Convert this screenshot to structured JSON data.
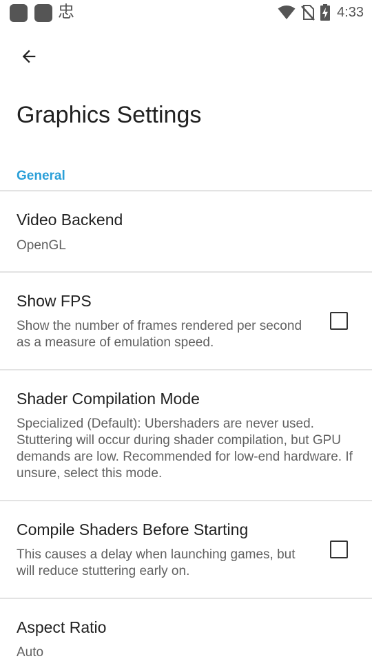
{
  "status_bar": {
    "glyph": "忠",
    "time": "4:33",
    "icons": [
      "app-icon",
      "app-icon",
      "wifi-icon",
      "no-sim-icon",
      "battery-charging-icon"
    ]
  },
  "toolbar": {
    "back_icon": "arrow-back-icon",
    "title": "Graphics Settings"
  },
  "category": "General",
  "items": [
    {
      "title": "Video Backend",
      "summary": "OpenGL"
    },
    {
      "title": "Show FPS",
      "summary": "Show the number of frames rendered per second as a measure of emulation speed.",
      "checked": false
    },
    {
      "title": "Shader Compilation Mode",
      "summary": "Specialized (Default): Ubershaders are never used. Stuttering will occur during shader compilation, but GPU demands are low. Recommended for low-end hardware. If unsure, select this mode."
    },
    {
      "title": "Compile Shaders Before Starting",
      "summary": "This causes a delay when launching games, but will reduce stuttering early on.",
      "checked": false
    },
    {
      "title": "Aspect Ratio",
      "summary": "Auto"
    }
  ],
  "colors": {
    "accent": "#2a9fd8",
    "text_primary": "#212121",
    "text_secondary": "#616161",
    "divider": "#e3e3e3"
  }
}
